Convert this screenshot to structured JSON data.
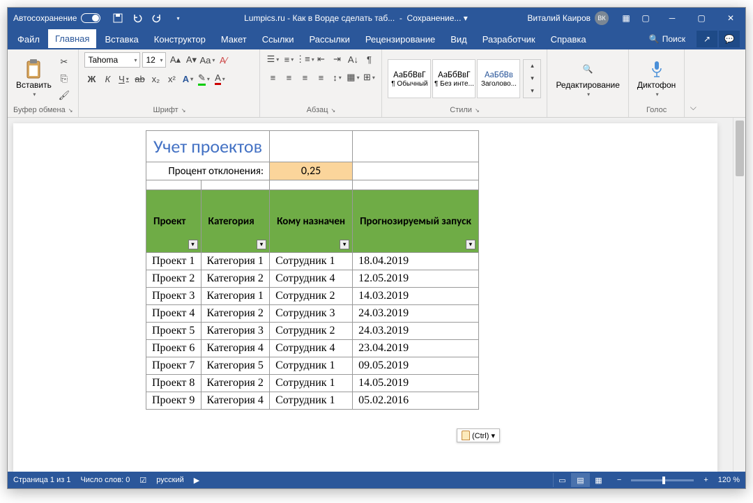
{
  "titlebar": {
    "autosave": "Автосохранение",
    "doc_title": "Lumpics.ru - Как в Ворде сделать таб...",
    "saving": "Сохранение...",
    "user": "Виталий Каиров",
    "initials": "ВК"
  },
  "tabs": [
    "Файл",
    "Главная",
    "Вставка",
    "Конструктор",
    "Макет",
    "Ссылки",
    "Рассылки",
    "Рецензирование",
    "Вид",
    "Разработчик",
    "Справка"
  ],
  "search_label": "Поиск",
  "ribbon": {
    "clipboard": {
      "paste": "Вставить",
      "label": "Буфер обмена"
    },
    "font": {
      "name": "Tahoma",
      "size": "12",
      "label": "Шрифт",
      "bold": "Ж",
      "italic": "К",
      "underline": "Ч",
      "strike": "ab"
    },
    "paragraph": {
      "label": "Абзац"
    },
    "styles": {
      "label": "Стили",
      "items": [
        {
          "preview": "АаБбВвГ",
          "name": "¶ Обычный"
        },
        {
          "preview": "АаБбВвГ",
          "name": "¶ Без инте..."
        },
        {
          "preview": "АаБбВв",
          "name": "Заголово..."
        }
      ]
    },
    "editing": {
      "label": "Редактирование"
    },
    "voice": {
      "btn": "Диктофон",
      "label": "Голос"
    }
  },
  "document": {
    "title": "Учет проектов",
    "pct_label": "Процент отклонения:",
    "pct_value": "0,25",
    "headers": [
      "Проект",
      "Категория",
      "Кому назначен",
      "Прогнозируемый запуск"
    ],
    "rows": [
      [
        "Проект 1",
        "Категория 1",
        "Сотрудник 1",
        "18.04.2019"
      ],
      [
        "Проект 2",
        "Категория 2",
        "Сотрудник 4",
        "12.05.2019"
      ],
      [
        "Проект 3",
        "Категория 1",
        "Сотрудник 2",
        "14.03.2019"
      ],
      [
        "Проект 4",
        "Категория 2",
        "Сотрудник 3",
        "24.03.2019"
      ],
      [
        "Проект 5",
        "Категория 3",
        "Сотрудник 2",
        "24.03.2019"
      ],
      [
        "Проект 6",
        "Категория 4",
        "Сотрудник 4",
        "23.04.2019"
      ],
      [
        "Проект 7",
        "Категория 5",
        "Сотрудник 1",
        "09.05.2019"
      ],
      [
        "Проект 8",
        "Категория 2",
        "Сотрудник 1",
        "14.05.2019"
      ],
      [
        "Проект 9",
        "Категория 4",
        "Сотрудник 1",
        "05.02.2016"
      ]
    ]
  },
  "paste_tag": "(Ctrl) ▾",
  "statusbar": {
    "page": "Страница 1 из 1",
    "words": "Число слов: 0",
    "lang": "русский",
    "zoom": "120 %"
  }
}
